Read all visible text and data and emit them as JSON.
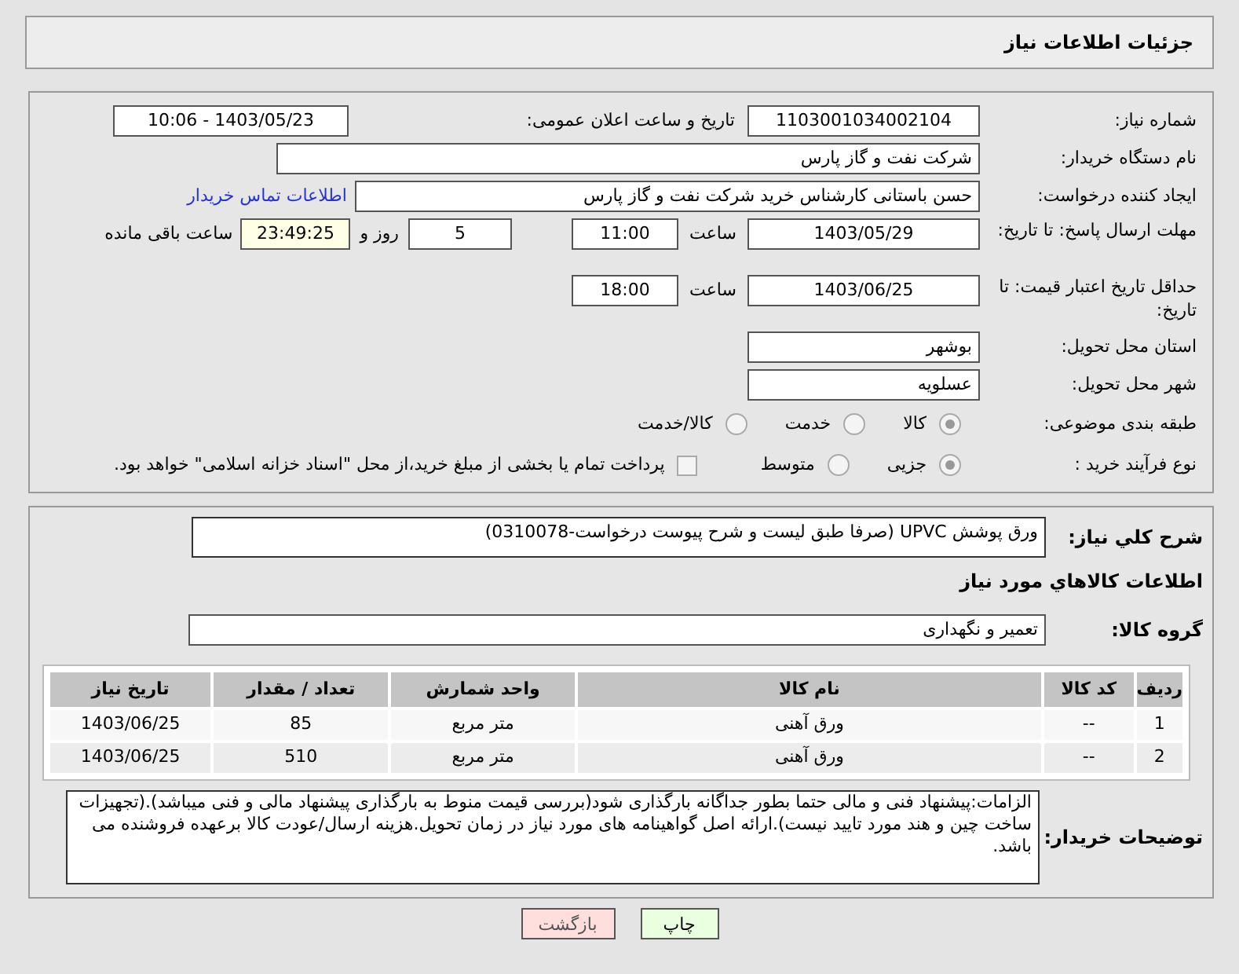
{
  "header": {
    "title": "جزئیات اطلاعات نیاز"
  },
  "form": {
    "need_number": {
      "label": "شماره نیاز:",
      "value": "1103001034002104"
    },
    "announce": {
      "label": "تاریخ و ساعت اعلان عمومی:",
      "value": "1403/05/23 - 10:06"
    },
    "buyer": {
      "label": "نام دستگاه خریدار:",
      "value": "شرکت نفت و گاز پارس"
    },
    "requester": {
      "label": "ایجاد کننده درخواست:",
      "value": "حسن باستانی کارشناس خرید شرکت نفت و گاز پارس",
      "link": "اطلاعات تماس خریدار"
    },
    "deadline": {
      "label": "مهلت ارسال پاسخ: تا تاریخ:",
      "date": "1403/05/29",
      "time_label": "ساعت",
      "time": "11:00",
      "days": "5",
      "days_label": "روز و",
      "remaining": "23:49:25",
      "remaining_label": "ساعت باقی مانده"
    },
    "validity": {
      "label": "حداقل تاریخ اعتبار قیمت: تا تاریخ:",
      "date": "1403/06/25",
      "time_label": "ساعت",
      "time": "18:00"
    },
    "province": {
      "label": "استان محل تحویل:",
      "value": "بوشهر"
    },
    "city": {
      "label": "شهر محل تحویل:",
      "value": "عسلویه"
    },
    "category": {
      "label": "طبقه بندی موضوعی:",
      "options": [
        {
          "label": "کالا",
          "selected": true
        },
        {
          "label": "خدمت",
          "selected": false
        },
        {
          "label": "کالا/خدمت",
          "selected": false
        }
      ]
    },
    "process": {
      "label": "نوع فرآیند خرید :",
      "options": [
        {
          "label": "جزیی",
          "selected": true
        },
        {
          "label": "متوسط",
          "selected": false
        }
      ],
      "payment": {
        "label": "پرداخت تمام یا بخشی از مبلغ خرید،از محل \"اسناد خزانه اسلامی\" خواهد بود.",
        "checked": false
      }
    }
  },
  "details": {
    "summary_label": "شرح كلي نياز:",
    "summary": "ورق پوشش UPVC  (صرفا طبق لیست و شرح پیوست درخواست-0310078)",
    "goods_heading": "اطلاعات كالاهاي مورد نياز",
    "group_label": "گروه کالا:",
    "group": "تعمیر و نگهداری",
    "table": {
      "columns": [
        "ردیف",
        "کد کالا",
        "نام کالا",
        "واحد شمارش",
        "تعداد / مقدار",
        "تاریخ نیاز"
      ],
      "rows": [
        [
          "1",
          "--",
          "ورق آهنی",
          "متر مربع",
          "85",
          "1403/06/25"
        ],
        [
          "2",
          "--",
          "ورق آهنی",
          "متر مربع",
          "510",
          "1403/06/25"
        ]
      ]
    },
    "notes_label": "توضیحات خریدار:",
    "notes": "الزامات:پیشنهاد فنی و مالی حتما  بطور جداگانه بارگذاری شود(بررسی قیمت منوط به بارگذاری پیشنهاد مالی و فنی میباشد).(تجهیزات ساخت چین و هند مورد تایید نیست).ارائه اصل گواهینامه های مورد نیاز در زمان تحویل.هزینه ارسال/عودت کالا برعهده فروشنده می باشد."
  },
  "buttons": [
    {
      "label": "چاپ",
      "kind": "print"
    },
    {
      "label": "بازگشت",
      "kind": "back"
    }
  ]
}
